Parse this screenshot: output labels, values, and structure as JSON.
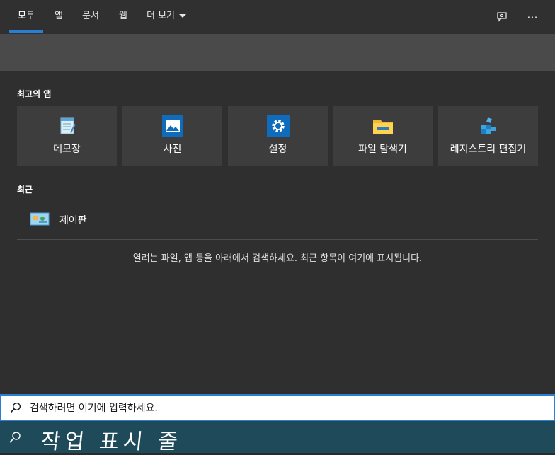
{
  "tabs": [
    {
      "label": "모두"
    },
    {
      "label": "앱"
    },
    {
      "label": "문서"
    },
    {
      "label": "웹"
    },
    {
      "label": "더 보기"
    }
  ],
  "top_icons": {
    "feedback": "feedback-icon",
    "more": "···"
  },
  "sections": {
    "top_apps": "최고의 앱",
    "recent": "최근"
  },
  "apps": [
    {
      "label": "메모장",
      "icon": "notepad-icon"
    },
    {
      "label": "사진",
      "icon": "photos-icon"
    },
    {
      "label": "설정",
      "icon": "settings-gear-icon"
    },
    {
      "label": "파일 탐색기",
      "icon": "folder-icon"
    },
    {
      "label": "레지스트리 편집기",
      "icon": "registry-icon"
    }
  ],
  "recent_items": [
    {
      "label": "제어판",
      "icon": "control-panel-icon"
    }
  ],
  "hint": "열려는 파일, 앱 등을 아래에서 검색하세요. 최근 항목이 여기에 표시됩니다.",
  "search": {
    "placeholder": "검색하려면 여기에 입력하세요."
  },
  "taskbar": {
    "label": "작업 표시 줄"
  },
  "colors": {
    "accent": "#2a7fd4",
    "tile_bg": "#3d3d3d",
    "taskbar_bg": "#1f4a5a"
  }
}
